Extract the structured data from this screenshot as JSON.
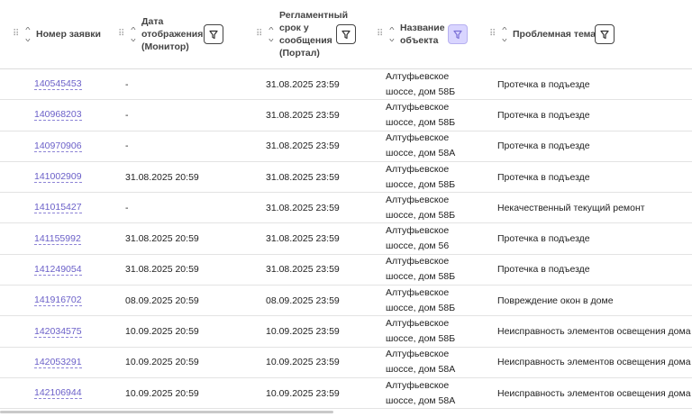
{
  "columns": [
    {
      "title": "Номер заявки"
    },
    {
      "title": "Дата отображения (Монитор)"
    },
    {
      "title": "Регламентный срок у сообщения (Портал)"
    },
    {
      "title": "Название объекта"
    },
    {
      "title": "Проблемная тема"
    }
  ],
  "header_lines": {
    "c1": [
      "Номер заявки"
    ],
    "c2": [
      "Дата",
      "отображения",
      "(Монитор)"
    ],
    "c3": [
      "Регламентный",
      "срок у",
      "сообщения",
      "(Портал)"
    ],
    "c4": [
      "Название",
      "объекта"
    ],
    "c5": [
      "Проблемная тема"
    ]
  },
  "filters": {
    "c2": {
      "icon": "filter-icon",
      "active": false
    },
    "c3": {
      "icon": "filter-icon",
      "active": false
    },
    "c4": {
      "icon": "filter-icon",
      "active": true
    },
    "c5": {
      "icon": "filter-icon",
      "active": false
    }
  },
  "colors": {
    "link": "#6a5fc8",
    "active_filter_bg": "#d9d5ff"
  },
  "rows": [
    {
      "id": "140545453",
      "monitor": "-",
      "portal": "31.08.2025 23:59",
      "object_l1": "Алтуфьевское",
      "object_l2": "шоссе, дом 58Б",
      "topic": "Протечка в подъезде"
    },
    {
      "id": "140968203",
      "monitor": "-",
      "portal": "31.08.2025 23:59",
      "object_l1": "Алтуфьевское",
      "object_l2": "шоссе, дом 58Б",
      "topic": "Протечка в подъезде"
    },
    {
      "id": "140970906",
      "monitor": "-",
      "portal": "31.08.2025 23:59",
      "object_l1": "Алтуфьевское",
      "object_l2": "шоссе, дом 58А",
      "topic": "Протечка в подъезде"
    },
    {
      "id": "141002909",
      "monitor": "31.08.2025 20:59",
      "portal": "31.08.2025 23:59",
      "object_l1": "Алтуфьевское",
      "object_l2": "шоссе, дом 58Б",
      "topic": "Протечка в подъезде"
    },
    {
      "id": "141015427",
      "monitor": "-",
      "portal": "31.08.2025 23:59",
      "object_l1": "Алтуфьевское",
      "object_l2": "шоссе, дом 58Б",
      "topic": "Некачественный текущий ремонт"
    },
    {
      "id": "141155992",
      "monitor": "31.08.2025 20:59",
      "portal": "31.08.2025 23:59",
      "object_l1": "Алтуфьевское",
      "object_l2": "шоссе, дом 56",
      "topic": "Протечка в подъезде"
    },
    {
      "id": "141249054",
      "monitor": "31.08.2025 20:59",
      "portal": "31.08.2025 23:59",
      "object_l1": "Алтуфьевское",
      "object_l2": "шоссе, дом 58Б",
      "topic": "Протечка в подъезде"
    },
    {
      "id": "141916702",
      "monitor": "08.09.2025 20:59",
      "portal": "08.09.2025 23:59",
      "object_l1": "Алтуфьевское",
      "object_l2": "шоссе, дом 58Б",
      "topic": "Повреждение окон в доме"
    },
    {
      "id": "142034575",
      "monitor": "10.09.2025 20:59",
      "portal": "10.09.2025 23:59",
      "object_l1": "Алтуфьевское",
      "object_l2": "шоссе, дом 58Б",
      "topic": "Неисправность элементов освещения дома"
    },
    {
      "id": "142053291",
      "monitor": "10.09.2025 20:59",
      "portal": "10.09.2025 23:59",
      "object_l1": "Алтуфьевское",
      "object_l2": "шоссе, дом 58А",
      "topic": "Неисправность элементов освещения дома"
    },
    {
      "id": "142106944",
      "monitor": "10.09.2025 20:59",
      "portal": "10.09.2025 23:59",
      "object_l1": "Алтуфьевское",
      "object_l2": "шоссе, дом 58А",
      "topic": "Неисправность элементов освещения дома"
    }
  ]
}
